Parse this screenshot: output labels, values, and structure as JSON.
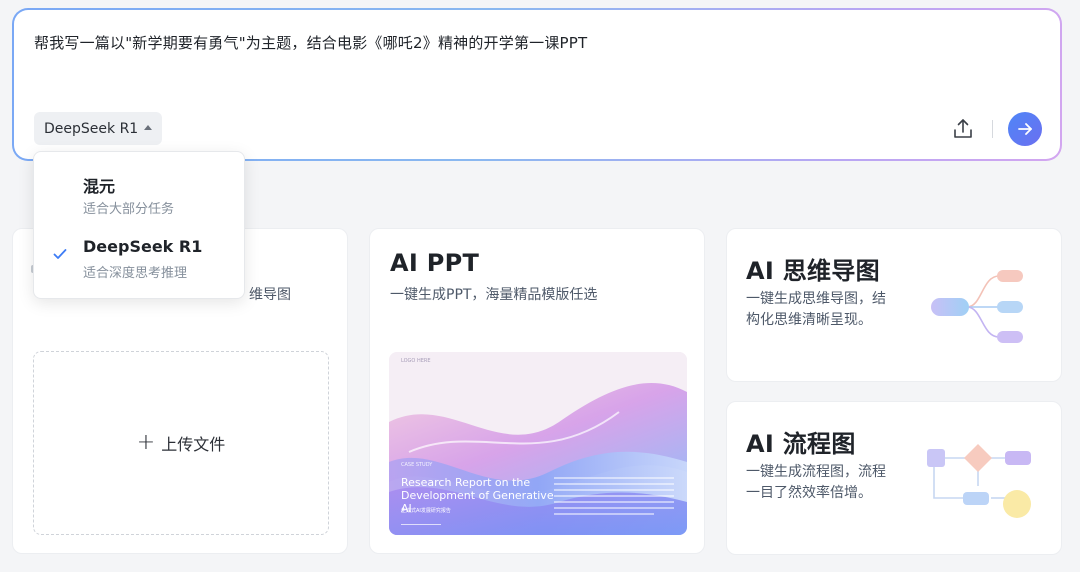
{
  "prompt": {
    "text": "帮我写一篇以\"新学期要有勇气\"为主题，结合电影《哪吒2》精神的开学第一课PPT",
    "model": "DeepSeek R1"
  },
  "dropdown": {
    "options": [
      {
        "name": "混元",
        "desc": "适合大部分任务",
        "selected": false
      },
      {
        "name": "DeepSeek R1",
        "desc": "适合深度思考推理",
        "selected": true
      }
    ]
  },
  "cards": {
    "doc": {
      "subtitle_fragment": "维导图",
      "upload_label": "上传文件"
    },
    "ppt": {
      "title": "AI PPT",
      "subtitle": "一键生成PPT，海量精品模版任选",
      "thumb": {
        "logo": "LOGO HERE",
        "case": "CASE STUDY",
        "title": "Research Report on the Development of Generative AI",
        "subtitle": "生成式AI发展研究报告"
      }
    },
    "mindmap": {
      "title": "AI 思维导图",
      "subtitle": "一键生成思维导图，结构化思维清晰呈现。"
    },
    "flowchart": {
      "title": "AI 流程图",
      "subtitle": "一键生成流程图，流程一目了然效率倍增。"
    }
  },
  "colors": {
    "accent": "#4f7ff5",
    "check": "#3d7cf5"
  }
}
